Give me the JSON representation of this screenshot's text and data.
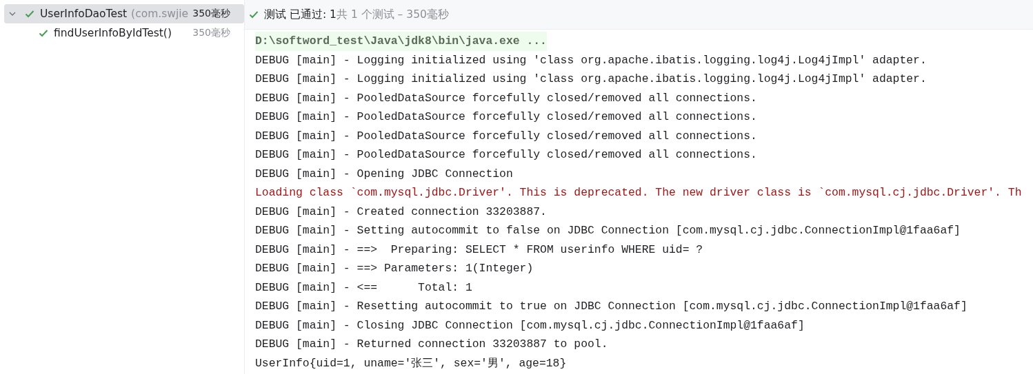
{
  "tree": {
    "items": [
      {
        "name": "UserInfoDaoTest",
        "package": "(com.swjie",
        "time": "350毫秒",
        "passed": true,
        "selected": true,
        "expanded": true,
        "children": [
          {
            "name": "findUserInfoByIdTest()",
            "time": "350毫秒",
            "passed": true,
            "selected": false
          }
        ]
      }
    ]
  },
  "status": {
    "passed": true,
    "label": "测试 已通过: 1",
    "detail": "共 1 个测试 – 350毫秒"
  },
  "console": {
    "lines": [
      {
        "kind": "command",
        "text": "D:\\softword_test\\Java\\jdk8\\bin\\java.exe ..."
      },
      {
        "kind": "log",
        "text": "DEBUG [main] - Logging initialized using 'class org.apache.ibatis.logging.log4j.Log4jImpl' adapter."
      },
      {
        "kind": "log",
        "text": "DEBUG [main] - Logging initialized using 'class org.apache.ibatis.logging.log4j.Log4jImpl' adapter."
      },
      {
        "kind": "log",
        "text": "DEBUG [main] - PooledDataSource forcefully closed/removed all connections."
      },
      {
        "kind": "log",
        "text": "DEBUG [main] - PooledDataSource forcefully closed/removed all connections."
      },
      {
        "kind": "log",
        "text": "DEBUG [main] - PooledDataSource forcefully closed/removed all connections."
      },
      {
        "kind": "log",
        "text": "DEBUG [main] - PooledDataSource forcefully closed/removed all connections."
      },
      {
        "kind": "log",
        "text": "DEBUG [main] - Opening JDBC Connection"
      },
      {
        "kind": "error",
        "text": "Loading class `com.mysql.jdbc.Driver'. This is deprecated. The new driver class is `com.mysql.cj.jdbc.Driver'. Th"
      },
      {
        "kind": "log",
        "text": "DEBUG [main] - Created connection 33203887."
      },
      {
        "kind": "log",
        "text": "DEBUG [main] - Setting autocommit to false on JDBC Connection [com.mysql.cj.jdbc.ConnectionImpl@1faa6af]"
      },
      {
        "kind": "log",
        "text": "DEBUG [main] - ==>  Preparing: SELECT * FROM userinfo WHERE uid= ?"
      },
      {
        "kind": "log",
        "text": "DEBUG [main] - ==> Parameters: 1(Integer)"
      },
      {
        "kind": "log",
        "text": "DEBUG [main] - <==      Total: 1"
      },
      {
        "kind": "log",
        "text": "DEBUG [main] - Resetting autocommit to true on JDBC Connection [com.mysql.cj.jdbc.ConnectionImpl@1faa6af]"
      },
      {
        "kind": "log",
        "text": "DEBUG [main] - Closing JDBC Connection [com.mysql.cj.jdbc.ConnectionImpl@1faa6af]"
      },
      {
        "kind": "log",
        "text": "DEBUG [main] - Returned connection 33203887 to pool."
      },
      {
        "kind": "log",
        "text": "UserInfo{uid=1, uname='张三', sex='男', age=18}"
      }
    ]
  }
}
